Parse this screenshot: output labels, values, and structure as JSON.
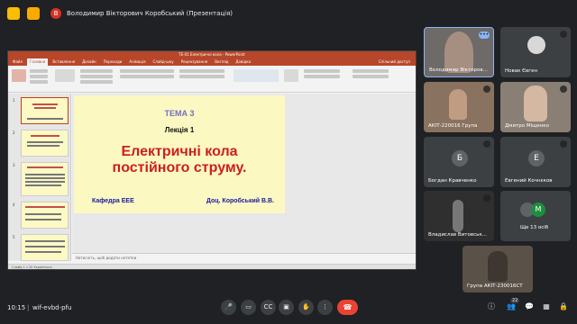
{
  "topbar": {
    "presenter_initial": "В",
    "presenter_text": "Володимир Вікторович Коробський (Презентація)",
    "icon_colors": [
      "#fbbc04",
      "#f28b82"
    ]
  },
  "ppt": {
    "window_title": "ТЕ-01 Електричні кола - PowerPoint",
    "tabs": [
      "Файл",
      "Головна",
      "Вставлення",
      "Дизайн",
      "Переходи",
      "Анімація",
      "Слайд-шоу",
      "Рецензування",
      "Вигляд",
      "Довідка"
    ],
    "active_tab_index": 1,
    "share_label": "Спільний доступ",
    "notes_placeholder": "Натисніть, щоб додати нотатки",
    "status_text": "Слайд 1 з 20   Українська",
    "thumb_numbers": [
      "1",
      "2",
      "3",
      "4",
      "5"
    ]
  },
  "slide": {
    "tema": "ТЕМА 3",
    "lecture": "Лекція 1",
    "title_line1": "Електричні кола",
    "title_line2": "постійного струму.",
    "department": "Кафедра ЕЕЕ",
    "author": "Доц. Коробський В.В."
  },
  "participants": [
    {
      "name": "Володимир Вікторов...",
      "kind": "video",
      "bg": "#6d6a68"
    },
    {
      "name": "Новак Євген",
      "kind": "video",
      "bg": "#4a4a4a"
    },
    {
      "name": "АКІТ-220016 Група",
      "kind": "video",
      "bg": "#8a7260"
    },
    {
      "name": "Дмитро Міщенко",
      "kind": "video",
      "bg": "#8a7f74"
    },
    {
      "name": "Богдан Кравченко",
      "kind": "avatar",
      "initial": "Б",
      "color": "#5f6368"
    },
    {
      "name": "Евгений Кочнєков",
      "kind": "avatar",
      "initial": "Е",
      "color": "#5f6368"
    },
    {
      "name": "Владислав Витовськ...",
      "kind": "video",
      "bg": "#2f2f2f"
    },
    {
      "name": "Ще 13 осіб",
      "kind": "more",
      "initial": "М",
      "color": "#1e8e3e"
    },
    {
      "name": "Група АКІТ-230016СТ",
      "kind": "video",
      "bg": "#5a5148"
    }
  ],
  "bottombar": {
    "time": "10:15",
    "meeting_code": "wif-evbd-pfu",
    "participant_count": "22",
    "end_call_icon": "phone-hangup-icon"
  }
}
